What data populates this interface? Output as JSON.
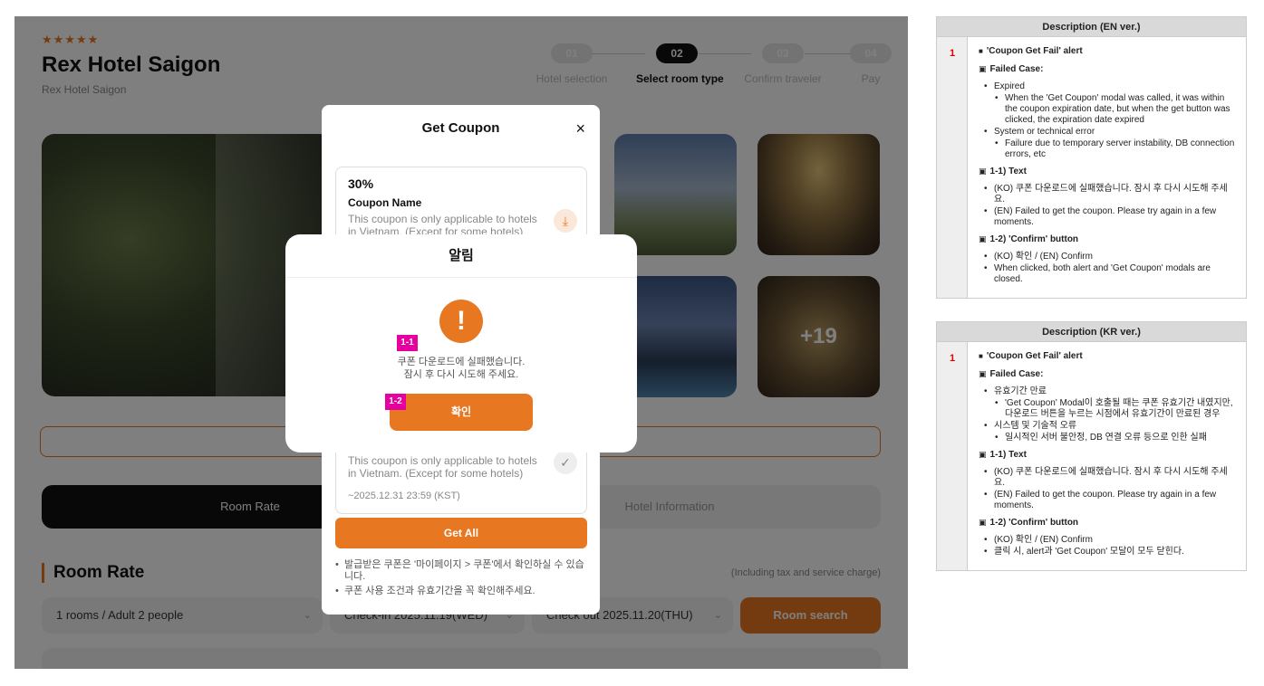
{
  "hotel": {
    "stars": "★★★★★",
    "name": "Rex Hotel Saigon",
    "subname": "Rex Hotel Saigon"
  },
  "steps": [
    {
      "num": "01",
      "label": "Hotel selection"
    },
    {
      "num": "02",
      "label": "Select room type"
    },
    {
      "num": "03",
      "label": "Confirm traveler"
    },
    {
      "num": "04",
      "label": "Pay"
    }
  ],
  "gallery": {
    "more_count": "+19"
  },
  "tabs": {
    "room_rate": "Room Rate",
    "hotel_info": "Hotel Information"
  },
  "room_rate": {
    "title": "Room Rate",
    "tax_note": "(Including tax and service charge)",
    "guests": "1 rooms / Adult 2 people",
    "checkin": "Check-in 2025.11.19(WED)",
    "checkout": "Check out 2025.11.20(THU)",
    "search_button": "Room search"
  },
  "coupon_modal": {
    "title": "Get Coupon",
    "close": "×",
    "cards": [
      {
        "percent": "30%",
        "name": "Coupon Name",
        "desc": "This coupon is only applicable to hotels in Vietnam. (Except for some hotels)"
      },
      {
        "desc": "This coupon is only applicable to hotels in Vietnam. (Except for some hotels)",
        "expiry": "~2025.12.31 23:59 (KST)"
      }
    ],
    "get_all": "Get All",
    "notes": [
      "발급받은 쿠폰은 '마이페이지 > 쿠폰'에서 확인하실 수 있습니다.",
      "쿠폰 사용 조건과 유효기간을 꼭 확인해주세요."
    ]
  },
  "alert": {
    "title": "알림",
    "icon": "!",
    "line1": "쿠폰 다운로드에 실패했습니다.",
    "line2": "잠시 후 다시 시도해 주세요.",
    "confirm": "확인",
    "tag_text": "1-1",
    "tag_button": "1-2"
  },
  "desc_en": {
    "header": "Description (EN ver.)",
    "num": "1",
    "title": "'Coupon Get Fail' alert",
    "failed_case": "Failed Case:",
    "case1": "Expired",
    "case1_detail": "When the 'Get Coupon' modal was called, it was within the coupon expiration date, but when the get button was clicked, the expiration date expired",
    "case2": "System or technical error",
    "case2_detail": "Failure due to temporary server instability, DB connection errors, etc",
    "text_h": "1-1) Text",
    "text_ko": "(KO) 쿠폰 다운로드에 실패했습니다. 잠시 후 다시 시도해 주세요.",
    "text_en": "(EN) Failed to get the coupon. Please try again in a few moments.",
    "btn_h": "1-2) 'Confirm' button",
    "btn_label": "(KO) 확인 / (EN) Confirm",
    "btn_action": "When clicked, both alert and 'Get Coupon' modals are closed."
  },
  "desc_kr": {
    "header": "Description (KR ver.)",
    "num": "1",
    "title": "'Coupon Get Fail' alert",
    "failed_case": "Failed Case:",
    "case1": "유효기간 만료",
    "case1_detail": "'Get Coupon' Modal이 호출될 때는 쿠폰 유효기간 내였지만, 다운로드 버튼을 누르는 시점에서 유효기간이 만료된 경우",
    "case2": "시스템 및 기술적 오류",
    "case2_detail": "일시적인 서버 불안정, DB 연결 오류 등으로 인한 실패",
    "text_h": "1-1) Text",
    "text_ko": "(KO) 쿠폰 다운로드에 실패했습니다. 잠시 후 다시 시도해 주세요.",
    "text_en": "(EN) Failed to get the coupon. Please try again in a few moments.",
    "btn_h": "1-2) 'Confirm' button",
    "btn_label": "(KO) 확인 / (EN) Confirm",
    "btn_action": "클릭 시, alert과 'Get Coupon' 모달이 모두 닫힌다."
  },
  "colors": {
    "accent": "#e87722",
    "tag": "#e600a0",
    "number": "#e00000"
  }
}
